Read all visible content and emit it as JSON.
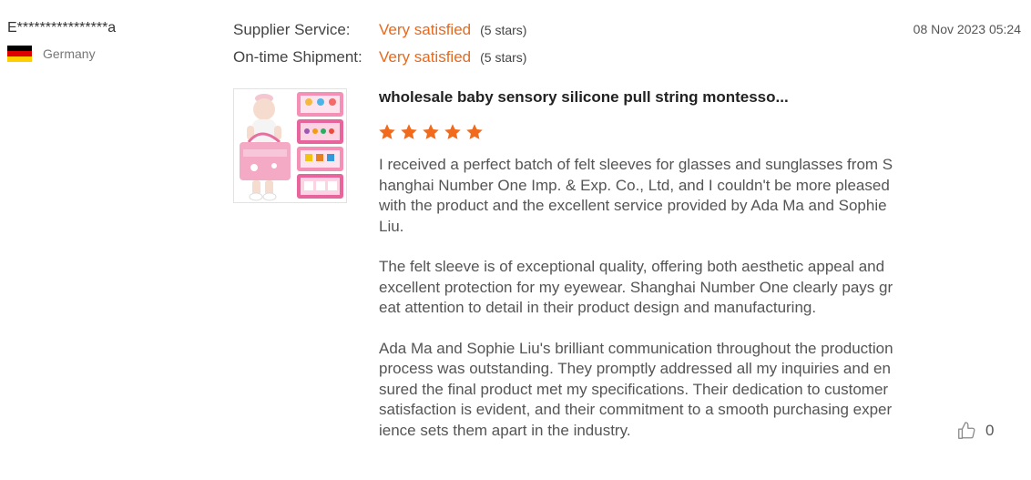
{
  "reviewer": {
    "name": "E****************a",
    "country": "Germany",
    "flag_colors": [
      "#000000",
      "#dd0000",
      "#ffce00"
    ]
  },
  "ratings": [
    {
      "label": "Supplier Service:",
      "value": "Very satisfied",
      "stars_text": "(5 stars)"
    },
    {
      "label": "On-time Shipment:",
      "value": "Very satisfied",
      "stars_text": "(5 stars)"
    }
  ],
  "date": "08 Nov 2023 05:24",
  "product": {
    "title": "wholesale baby sensory silicone pull string montesso...",
    "rating": 5,
    "star_color": "#f26a1b"
  },
  "review": {
    "paragraphs": [
      "I received a perfect batch of felt sleeves for glasses and sunglasses from Shanghai Number One Imp. & Exp. Co., Ltd, and I couldn't be more pleased with the product and the excellent service provided by Ada Ma and Sophie Liu.",
      "The felt sleeve is of exceptional quality, offering both aesthetic appeal and excellent protection for my eyewear. Shanghai Number One clearly pays great attention to detail in their product design and manufacturing.",
      "Ada Ma and Sophie Liu's brilliant communication throughout the production process was outstanding. They promptly addressed all my inquiries and ensured the final product met my specifications. Their dedication to customer satisfaction is evident, and their commitment to a smooth purchasing experience sets them apart in the industry."
    ]
  },
  "likes": {
    "count": "0",
    "icon": "thumbs-up-icon"
  },
  "accent_color": "#e8691c"
}
